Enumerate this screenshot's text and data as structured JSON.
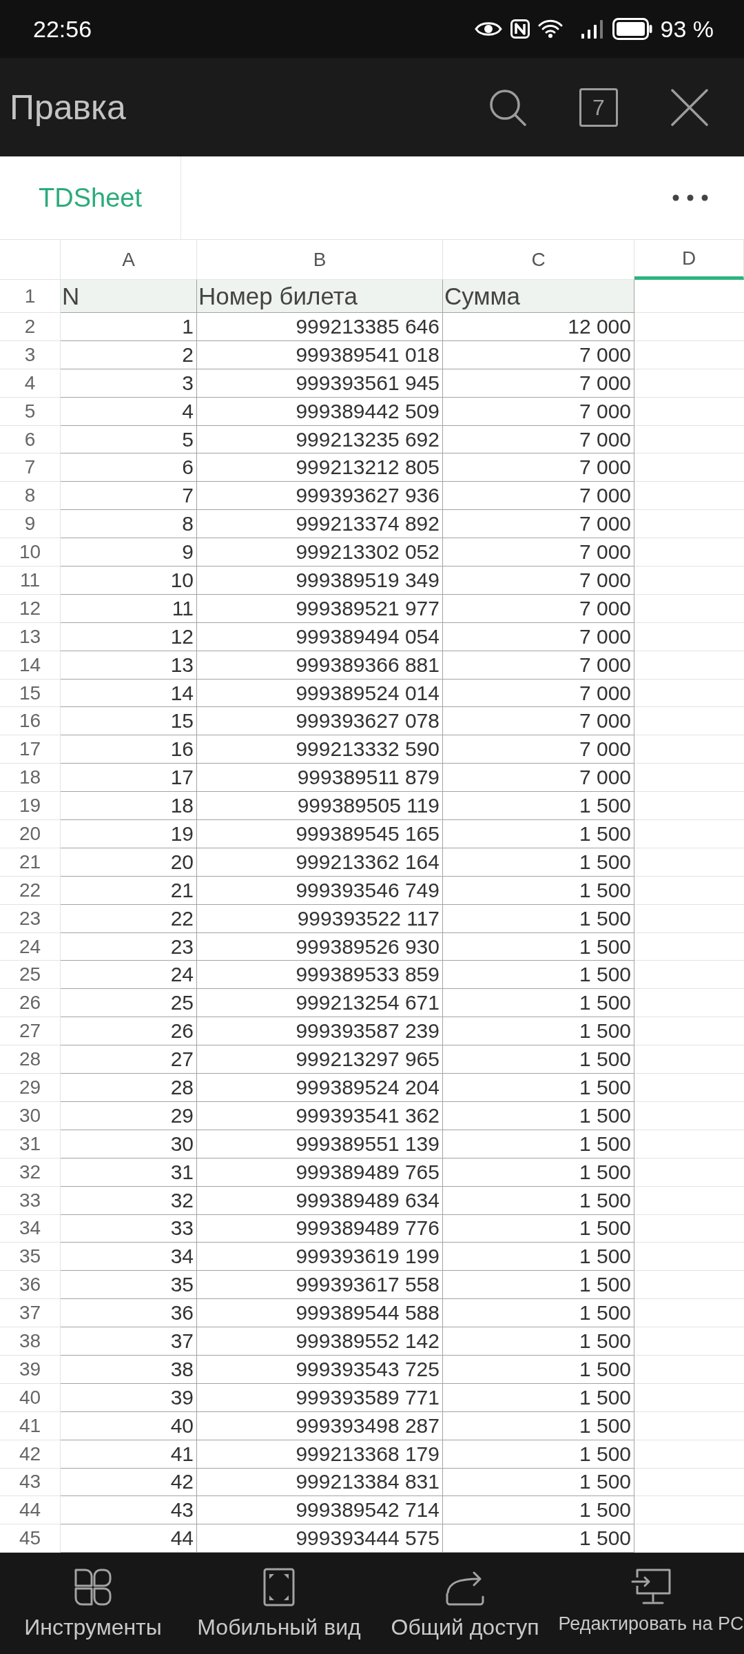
{
  "status_bar": {
    "time": "22:56",
    "battery_text": "93 %"
  },
  "toolbar": {
    "title": "Правка",
    "tab_count": "7"
  },
  "sheet_tabs": [
    {
      "label": "TDSheet",
      "selected": true
    }
  ],
  "sheet": {
    "columns": [
      {
        "label": "A",
        "selected": false
      },
      {
        "label": "B",
        "selected": false
      },
      {
        "label": "C",
        "selected": false
      },
      {
        "label": "D",
        "selected": true
      }
    ],
    "header_row": {
      "number": "1",
      "cells": [
        "N",
        "Номер билета",
        "Сумма"
      ]
    },
    "rows": [
      {
        "number": "2",
        "cells": [
          "1",
          "999213385 646",
          "12 000"
        ]
      },
      {
        "number": "3",
        "cells": [
          "2",
          "999389541 018",
          "7 000"
        ]
      },
      {
        "number": "4",
        "cells": [
          "3",
          "999393561 945",
          "7 000"
        ]
      },
      {
        "number": "5",
        "cells": [
          "4",
          "999389442 509",
          "7 000"
        ]
      },
      {
        "number": "6",
        "cells": [
          "5",
          "999213235 692",
          "7 000"
        ]
      },
      {
        "number": "7",
        "cells": [
          "6",
          "999213212 805",
          "7 000"
        ]
      },
      {
        "number": "8",
        "cells": [
          "7",
          "999393627 936",
          "7 000"
        ]
      },
      {
        "number": "9",
        "cells": [
          "8",
          "999213374 892",
          "7 000"
        ]
      },
      {
        "number": "10",
        "cells": [
          "9",
          "999213302 052",
          "7 000"
        ]
      },
      {
        "number": "11",
        "cells": [
          "10",
          "999389519 349",
          "7 000"
        ]
      },
      {
        "number": "12",
        "cells": [
          "11",
          "999389521 977",
          "7 000"
        ]
      },
      {
        "number": "13",
        "cells": [
          "12",
          "999389494 054",
          "7 000"
        ]
      },
      {
        "number": "14",
        "cells": [
          "13",
          "999389366 881",
          "7 000"
        ]
      },
      {
        "number": "15",
        "cells": [
          "14",
          "999389524 014",
          "7 000"
        ]
      },
      {
        "number": "16",
        "cells": [
          "15",
          "999393627 078",
          "7 000"
        ]
      },
      {
        "number": "17",
        "cells": [
          "16",
          "999213332 590",
          "7 000"
        ]
      },
      {
        "number": "18",
        "cells": [
          "17",
          "999389511 879",
          "7 000"
        ]
      },
      {
        "number": "19",
        "cells": [
          "18",
          "999389505 119",
          "1 500"
        ]
      },
      {
        "number": "20",
        "cells": [
          "19",
          "999389545 165",
          "1 500"
        ]
      },
      {
        "number": "21",
        "cells": [
          "20",
          "999213362 164",
          "1 500"
        ]
      },
      {
        "number": "22",
        "cells": [
          "21",
          "999393546 749",
          "1 500"
        ]
      },
      {
        "number": "23",
        "cells": [
          "22",
          "999393522 117",
          "1 500"
        ]
      },
      {
        "number": "24",
        "cells": [
          "23",
          "999389526 930",
          "1 500"
        ]
      },
      {
        "number": "25",
        "cells": [
          "24",
          "999389533 859",
          "1 500"
        ]
      },
      {
        "number": "26",
        "cells": [
          "25",
          "999213254 671",
          "1 500"
        ]
      },
      {
        "number": "27",
        "cells": [
          "26",
          "999393587 239",
          "1 500"
        ]
      },
      {
        "number": "28",
        "cells": [
          "27",
          "999213297 965",
          "1 500"
        ]
      },
      {
        "number": "29",
        "cells": [
          "28",
          "999389524 204",
          "1 500"
        ]
      },
      {
        "number": "30",
        "cells": [
          "29",
          "999393541 362",
          "1 500"
        ]
      },
      {
        "number": "31",
        "cells": [
          "30",
          "999389551 139",
          "1 500"
        ]
      },
      {
        "number": "32",
        "cells": [
          "31",
          "999389489 765",
          "1 500"
        ]
      },
      {
        "number": "33",
        "cells": [
          "32",
          "999389489 634",
          "1 500"
        ]
      },
      {
        "number": "34",
        "cells": [
          "33",
          "999389489 776",
          "1 500"
        ]
      },
      {
        "number": "35",
        "cells": [
          "34",
          "999393619 199",
          "1 500"
        ]
      },
      {
        "number": "36",
        "cells": [
          "35",
          "999393617 558",
          "1 500"
        ]
      },
      {
        "number": "37",
        "cells": [
          "36",
          "999389544 588",
          "1 500"
        ]
      },
      {
        "number": "38",
        "cells": [
          "37",
          "999389552 142",
          "1 500"
        ]
      },
      {
        "number": "39",
        "cells": [
          "38",
          "999393543 725",
          "1 500"
        ]
      },
      {
        "number": "40",
        "cells": [
          "39",
          "999393589 771",
          "1 500"
        ]
      },
      {
        "number": "41",
        "cells": [
          "40",
          "999393498 287",
          "1 500"
        ]
      },
      {
        "number": "42",
        "cells": [
          "41",
          "999213368 179",
          "1 500"
        ]
      },
      {
        "number": "43",
        "cells": [
          "42",
          "999213384 831",
          "1 500"
        ]
      },
      {
        "number": "44",
        "cells": [
          "43",
          "999389542 714",
          "1 500"
        ]
      },
      {
        "number": "45",
        "cells": [
          "44",
          "999393444 575",
          "1 500"
        ]
      }
    ]
  },
  "bottom_bar": [
    "Инструменты",
    "Мобильный вид",
    "Общий доступ",
    "Редактировать на PC"
  ]
}
